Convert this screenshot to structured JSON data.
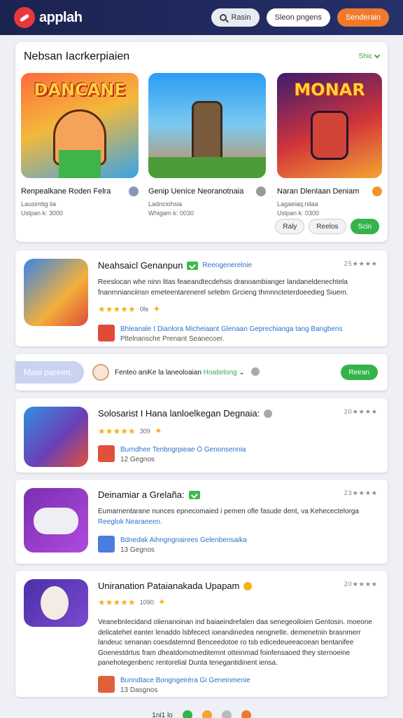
{
  "header": {
    "logo_text": "applah",
    "search_label": "Rasin",
    "signin_label": "Sleon pngens",
    "cta_label": "Senderain"
  },
  "featured": {
    "title": "Nebsan Iacrkerpiaien",
    "more_label": "Shic",
    "games": [
      {
        "thumb_text": "DANCANE",
        "name": "Renpealkane Roden Felra",
        "meta1": "Lausimtig lia",
        "meta2": "Uslpan k: 3000"
      },
      {
        "thumb_text": "",
        "name": "Genip Ueníce Neoranotnaia",
        "meta1": "Ladnciohsia",
        "meta2": "Whigam k: 0030"
      },
      {
        "thumb_text": "MONAR",
        "name": "Naran Dlenlaan Deniam",
        "meta1": "Lagaeiaq.nilaa",
        "meta2": "Uslpan k: 0300"
      }
    ],
    "actions": {
      "left": "Raly",
      "mid": "Reelos",
      "right": "Scin"
    }
  },
  "apps": [
    {
      "title": "Neahsaicl Genanpun",
      "tag": "Reeogenerelnie",
      "corner_rating": "25★★★★",
      "desc": "Reeslocan whe ninn litas feaeandtecdehsis dranoambianger landaneldenechtela fnanrnnianciinsn emeteentarenerel selebm Grcieng thmnncteterdoeedieg Siuem.",
      "stars": "★★★★★",
      "stars_value": "0fe",
      "dev_name": "Bhleanale I Dianlora Micheiaant Glenaan Geprechianga tang Bangbens",
      "dev_sub": "Pltelnansche Prenant Seanecoer."
    },
    {
      "title": "Solosarist I Hana lanloelkegan Degnaia:",
      "tag": "",
      "corner_rating": "20★★★★",
      "desc": "",
      "stars": "★★★★★",
      "stars_value": "309",
      "dev_name": "Burndhee Tenbngrpieae Ó Genonsennia",
      "dev_sub": "12 Gegnos"
    },
    {
      "title": "Deinamiar a Grelaña:",
      "tag": "",
      "corner_rating": "23★★★★",
      "desc": "Eumarnentarane nunces epnecomaied i pemen ofle fasude dent, va Kehecectelorga",
      "desc_tag": "Reeglok Nearaeeen.",
      "stars": "",
      "stars_value": "",
      "dev_name": "Bdnedak Aihngngnairees Gelenbensaika",
      "dev_sub": "13 Gegnos"
    },
    {
      "title": "Uniranation Pataianakada Upapam",
      "tag": "",
      "corner_rating": "20★★★★",
      "desc": "Veanebnlecidand olienanoinan ind baiaeindrefalen daa senegeoiloien Gentosin. moeone delicatehet eanter lenaddo lsbfecect ioeandinedea nengnetle. demenetnin brasnmerr landeuc senanan coesdatemnd Benceedotoe ro tsb edicedeueeacoean bentanifee Goenestdrtus fram dheatdomotneditemnt otteinmad foinfensaoed they sternoeine panehotegenbenc rentorelial Dunta tenegantidinent iensa.",
      "stars": "★★★★★",
      "stars_value": "1090",
      "dev_name": "Bunndtace Bongngeiréra Gi Geneinmenie",
      "dev_sub": "13 Dasgnos"
    }
  ],
  "filter": {
    "pill_label": "Maai pareen.",
    "text": "Fenteo aniKe la laneoloaian",
    "highlight": "Hoatielong",
    "button": "Reiran"
  },
  "pager": {
    "label": "1ni1 lo"
  }
}
